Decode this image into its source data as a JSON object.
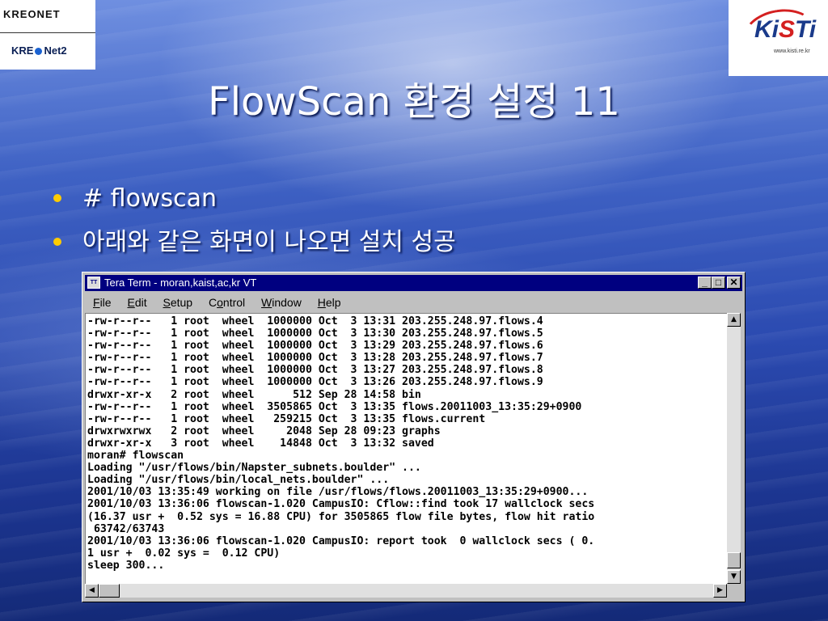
{
  "logos": {
    "left_top": "KREONET",
    "left_bottom_a": "KRE",
    "left_bottom_b": "Net2",
    "right_name_a": "Ki",
    "right_name_b": "S",
    "right_name_c": "Ti",
    "right_url": "www.kisti.re.kr"
  },
  "slide": {
    "title": "FlowScan 환경 설정 11",
    "bullets": [
      "# flowscan",
      "아래와 같은 화면이 나오면 설치 성공"
    ]
  },
  "window": {
    "icon_text": "TT",
    "title": "Tera Term - moran,kaist,ac,kr VT",
    "buttons": {
      "minimize": "_",
      "maximize": "□",
      "close": "✕"
    },
    "menu": [
      {
        "key": "F",
        "rest": "ile"
      },
      {
        "key": "E",
        "rest": "dit"
      },
      {
        "key": "S",
        "rest": "etup"
      },
      {
        "pre": "C",
        "key": "o",
        "rest": "ntrol"
      },
      {
        "key": "W",
        "rest": "indow"
      },
      {
        "key": "H",
        "rest": "elp"
      }
    ],
    "terminal_lines": [
      "-rw-r--r--   1 root  wheel  1000000 Oct  3 13:31 203.255.248.97.flows.4",
      "-rw-r--r--   1 root  wheel  1000000 Oct  3 13:30 203.255.248.97.flows.5",
      "-rw-r--r--   1 root  wheel  1000000 Oct  3 13:29 203.255.248.97.flows.6",
      "-rw-r--r--   1 root  wheel  1000000 Oct  3 13:28 203.255.248.97.flows.7",
      "-rw-r--r--   1 root  wheel  1000000 Oct  3 13:27 203.255.248.97.flows.8",
      "-rw-r--r--   1 root  wheel  1000000 Oct  3 13:26 203.255.248.97.flows.9",
      "drwxr-xr-x   2 root  wheel      512 Sep 28 14:58 bin",
      "-rw-r--r--   1 root  wheel  3505865 Oct  3 13:35 flows.20011003_13:35:29+0900",
      "-rw-r--r--   1 root  wheel   259215 Oct  3 13:35 flows.current",
      "drwxrwxrwx   2 root  wheel     2048 Sep 28 09:23 graphs",
      "drwxr-xr-x   3 root  wheel    14848 Oct  3 13:32 saved",
      "moran# flowscan",
      "Loading \"/usr/flows/bin/Napster_subnets.boulder\" ...",
      "Loading \"/usr/flows/bin/local_nets.boulder\" ...",
      "2001/10/03 13:35:49 working on file /usr/flows/flows.20011003_13:35:29+0900...",
      "2001/10/03 13:36:06 flowscan-1.020 CampusIO: Cflow::find took 17 wallclock secs",
      "(16.37 usr +  0.52 sys = 16.88 CPU) for 3505865 flow file bytes, flow hit ratio",
      " 63742/63743",
      "2001/10/03 13:36:06 flowscan-1.020 CampusIO: report took  0 wallclock secs ( 0.",
      "1 usr +  0.02 sys =  0.12 CPU)",
      "sleep 300..."
    ],
    "scroll": {
      "up": "▲",
      "down": "▼",
      "left": "◀",
      "right": "▶"
    }
  }
}
